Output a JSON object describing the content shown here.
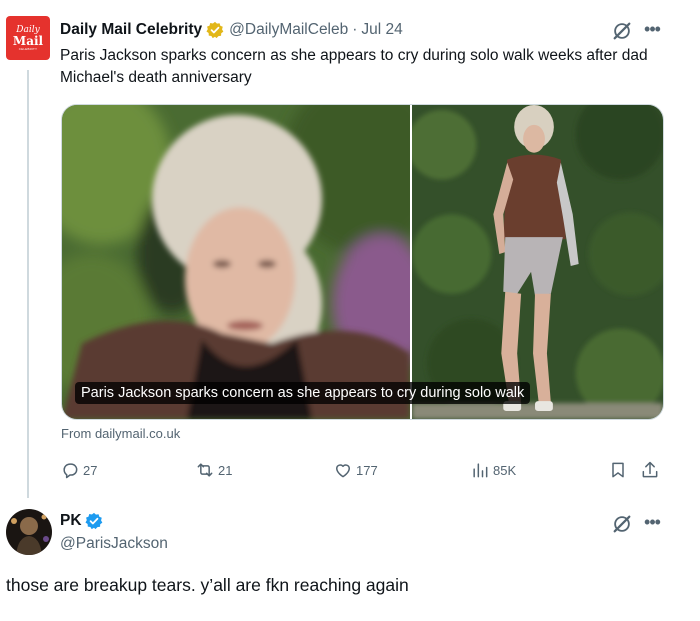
{
  "tweet": {
    "avatar_text": {
      "line1": "Daily",
      "line2": "Mail",
      "line3": "CELEBRITY"
    },
    "author_name": "Daily Mail Celebrity",
    "author_handle": "@DailyMailCeleb",
    "separator": "·",
    "date": "Jul 24",
    "text": "Paris Jackson sparks concern as she appears to cry during solo walk weeks after dad Michael's death anniversary",
    "media_caption": "Paris Jackson sparks concern as she appears to cry during solo walk",
    "source": "From dailymail.co.uk",
    "actions": {
      "replies": "27",
      "reposts": "21",
      "likes": "177",
      "views": "85K"
    },
    "icons": {
      "verified": "verified-gold-badge-icon",
      "grok": "grok-icon",
      "more": "more-icon",
      "reply": "reply-icon",
      "repost": "repost-icon",
      "like": "heart-icon",
      "views": "views-chart-icon",
      "bookmark": "bookmark-icon",
      "share": "share-icon"
    }
  },
  "reply": {
    "author_name": "PK",
    "author_handle": "@ParisJackson",
    "text": "those are breakup tears. y’all are fkn reaching again",
    "icons": {
      "verified": "verified-blue-badge-icon"
    }
  },
  "colors": {
    "text": "#0f1419",
    "secondary": "#536471",
    "dm_red": "#e5322d",
    "verified_gold": "#e2b719",
    "verified_blue": "#1d9bf0",
    "border": "#cfd9de"
  }
}
